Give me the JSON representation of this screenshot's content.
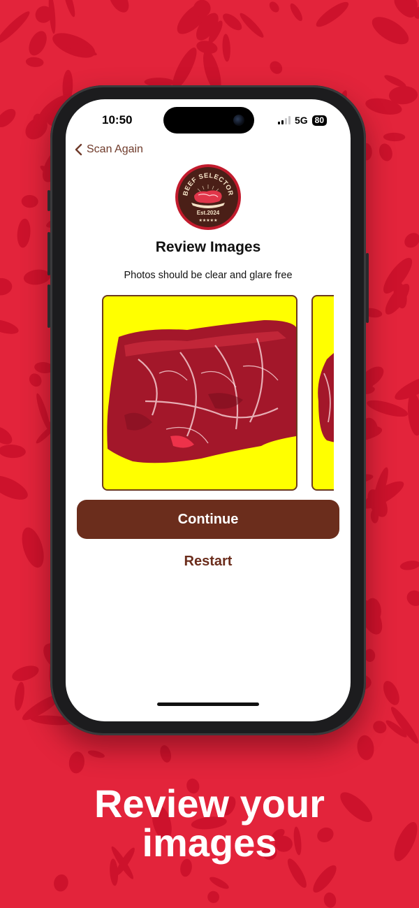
{
  "status": {
    "time": "10:50",
    "network": "5G",
    "battery": "80"
  },
  "nav": {
    "back_label": "Scan Again"
  },
  "logo": {
    "brand_text": "BEEF SELECTOR",
    "est_text": "Est.2024",
    "stars": "★★★★★"
  },
  "page": {
    "title": "Review Images",
    "subtitle": "Photos should be clear and glare free"
  },
  "actions": {
    "continue_label": "Continue",
    "restart_label": "Restart"
  },
  "marketing": {
    "caption_line1": "Review your",
    "caption_line2": "images"
  },
  "colors": {
    "background": "#e3243b",
    "brand_brown": "#6b2d1c",
    "photo_bg": "#ffff00"
  }
}
